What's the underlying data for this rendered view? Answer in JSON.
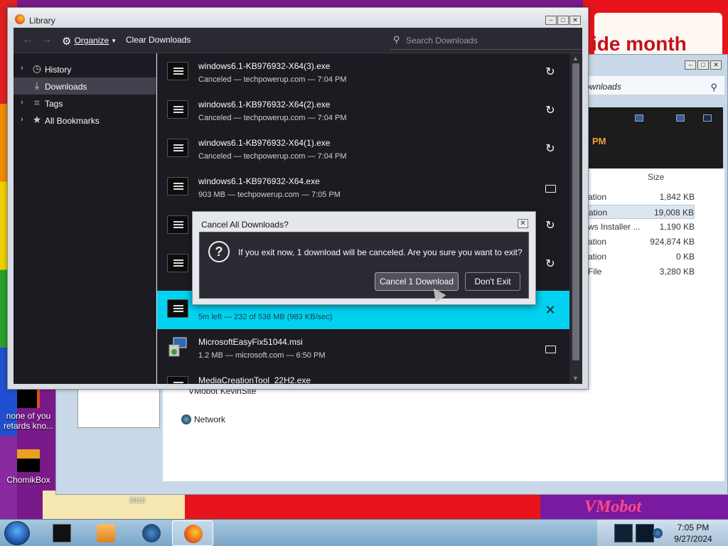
{
  "desktop": {
    "banner_text": "ide month",
    "year_label": "2015",
    "wallpaper_brand": "VMobot",
    "icons": [
      {
        "label": "none of you retards kno..."
      },
      {
        "label": "ChomikBox"
      }
    ]
  },
  "explorer": {
    "address": "ownloads",
    "pm_label": "PM",
    "size_header": "Size",
    "files": [
      {
        "name": "ation",
        "size": "1,842 KB"
      },
      {
        "name": "ation",
        "size": "19,008 KB"
      },
      {
        "name": "ws Installer ...",
        "size": "1,190 KB"
      },
      {
        "name": "ation",
        "size": "924,874 KB"
      },
      {
        "name": "ation",
        "size": "0 KB"
      },
      {
        "name": "File",
        "size": "3,280 KB"
      }
    ],
    "nav": {
      "vmobot_site": "VMobot KevinSite",
      "network": "Network"
    }
  },
  "library": {
    "title": "Library",
    "toolbar": {
      "organize_label": "Organize",
      "clear_label": "Clear Downloads",
      "search_placeholder": "Search Downloads"
    },
    "sidebar": [
      {
        "label": "History",
        "icon": "clock-icon"
      },
      {
        "label": "Downloads",
        "icon": "download-icon"
      },
      {
        "label": "Tags",
        "icon": "tag-icon"
      },
      {
        "label": "All Bookmarks",
        "icon": "star-icon"
      }
    ],
    "downloads": [
      {
        "name": "windows6.1-KB976932-X64(3).exe",
        "status": "Canceled — techpowerup.com — 7:04 PM",
        "action": "retry"
      },
      {
        "name": "windows6.1-KB976932-X64(2).exe",
        "status": "Canceled — techpowerup.com — 7:04 PM",
        "action": "retry"
      },
      {
        "name": "windows6.1-KB976932-X64(1).exe",
        "status": "Canceled — techpowerup.com — 7:04 PM",
        "action": "retry"
      },
      {
        "name": "windows6.1-KB976932-X64.exe",
        "status": "903 MB — techpowerup.com — 7:05 PM",
        "action": "folder"
      },
      {
        "name": "",
        "status": "",
        "action": "retry"
      },
      {
        "name": "",
        "status": "",
        "action": "retry"
      },
      {
        "name": "",
        "status": "5m left — 232 of 538 MB (983 KB/sec)",
        "action": "cancel"
      },
      {
        "name": "MicrosoftEasyFix51044.msi",
        "status": "1.2 MB — microsoft.com — 6:50 PM",
        "action": "folder"
      },
      {
        "name": "MediaCreationTool_22H2.exe",
        "status": "",
        "action": "folder"
      }
    ]
  },
  "dialog": {
    "title": "Cancel All Downloads?",
    "message": "If you exit now, 1 download will be canceled. Are you sure you want to exit?",
    "confirm_label": "Cancel 1 Download",
    "dismiss_label": "Don't Exit"
  },
  "taskbar": {
    "time": "7:05 PM",
    "date": "9/27/2024"
  }
}
